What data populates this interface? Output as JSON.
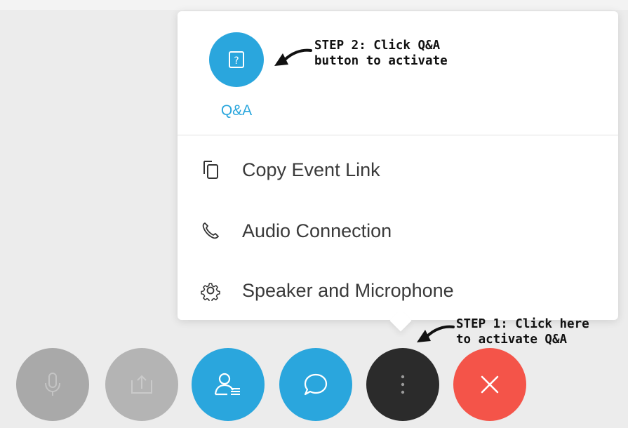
{
  "popup": {
    "qa_button": {
      "label": "Q&A",
      "icon": "question-box-icon",
      "color": "#2aa6dd"
    },
    "menu_items": [
      {
        "label": "Copy Event Link",
        "icon": "copy-icon"
      },
      {
        "label": "Audio Connection",
        "icon": "phone-icon"
      },
      {
        "label": "Speaker and Microphone",
        "icon": "gear-icon"
      }
    ]
  },
  "annotations": {
    "step2": "STEP 2: Click Q&A\nbutton to activate",
    "step1": "STEP 1: Click here\nto activate Q&A"
  },
  "toolbar": {
    "buttons": [
      {
        "name": "mute-button",
        "icon": "microphone-icon",
        "color": "#a9a9a9",
        "state": "disabled"
      },
      {
        "name": "share-button",
        "icon": "share-icon",
        "color": "#b4b4b4",
        "state": "disabled"
      },
      {
        "name": "participants-button",
        "icon": "participants-icon",
        "color": "#2aa6dd",
        "state": "enabled"
      },
      {
        "name": "chat-button",
        "icon": "chat-bubble-icon",
        "color": "#2aa6dd",
        "state": "enabled"
      },
      {
        "name": "more-options-button",
        "icon": "more-dots-icon",
        "color": "#2b2b2b",
        "state": "enabled"
      },
      {
        "name": "leave-button",
        "icon": "close-x-icon",
        "color": "#f45449",
        "state": "enabled"
      }
    ]
  },
  "colors": {
    "accent": "#2aa6dd",
    "danger": "#f45449",
    "dark": "#2b2b2b",
    "disabled": "#a9a9a9",
    "background": "#ececec"
  }
}
